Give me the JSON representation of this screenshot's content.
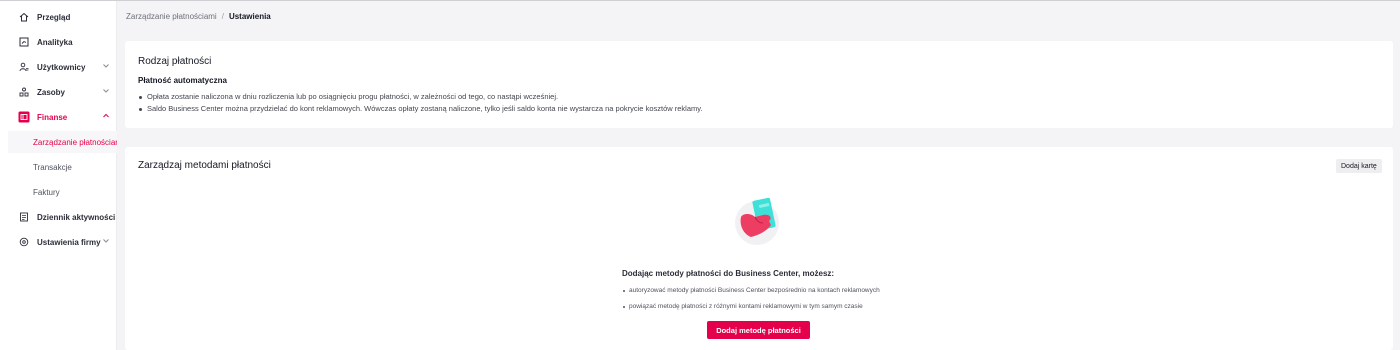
{
  "sidebar": {
    "items": [
      {
        "label": "Przegląd",
        "icon": "home-icon"
      },
      {
        "label": "Analityka",
        "icon": "chart-icon"
      },
      {
        "label": "Użytkownicy",
        "icon": "users-icon"
      },
      {
        "label": "Zasoby",
        "icon": "assets-icon"
      },
      {
        "label": "Finanse",
        "icon": "finance-icon"
      },
      {
        "label": "Dziennik aktywności",
        "icon": "log-icon"
      },
      {
        "label": "Ustawienia firmy",
        "icon": "settings-icon"
      }
    ],
    "finance_sub": [
      {
        "label": "Zarządzanie płatnościami"
      },
      {
        "label": "Transakcje"
      },
      {
        "label": "Faktury"
      }
    ]
  },
  "breadcrumb": {
    "parent": "Zarządzanie płatnościami",
    "separator": "/",
    "current": "Ustawienia"
  },
  "payment_type": {
    "title": "Rodzaj płatności",
    "subtitle": "Płatność automatyczna",
    "bullets": [
      "Opłata zostanie naliczona w dniu rozliczenia lub po osiągnięciu progu płatności, w zależności od tego, co nastąpi wcześniej.",
      "Saldo Business Center można przydzielać do kont reklamowych. Wówczas opłaty zostaną naliczone, tylko jeśli saldo konta nie wystarcza na pokrycie kosztów reklamy."
    ]
  },
  "payment_methods": {
    "title": "Zarządzaj metodami płatności",
    "add_card_label": "Dodaj kartę",
    "empty_title": "Dodając metody płatności do Business Center, możesz:",
    "empty_bullets": [
      "autoryzować metody płatności Business Center bezpośrednio na kontach reklamowych",
      "powiązać metodę płatności z różnymi kontami reklamowymi w tym samym czasie"
    ],
    "add_method_label": "Dodaj metodę płatności"
  },
  "colors": {
    "accent": "#e5004b",
    "card_illustration": "#3ee0d8"
  }
}
